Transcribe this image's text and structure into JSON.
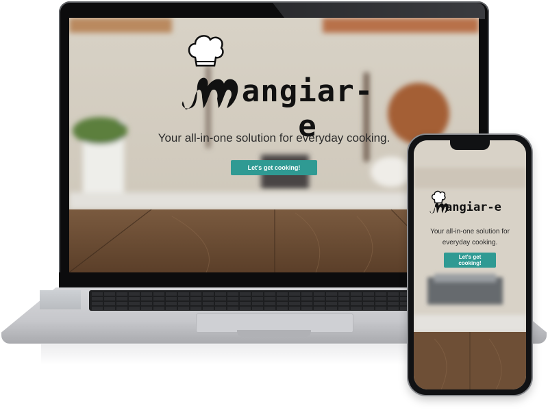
{
  "laptop": {
    "brand_name": "angiar-e",
    "tagline": "Your all-in-one solution for everyday cooking.",
    "cta_label": "Let's get cooking!"
  },
  "phone": {
    "brand_name": "angiar-e",
    "tagline": "Your all-in-one solution for everyday cooking.",
    "cta_label": "Let's get cooking!"
  },
  "colors": {
    "accent": "#2f9a93",
    "brand_text": "#111111",
    "device_frame": "#0c0c0d",
    "laptop_body": "#c6c7cb"
  },
  "icons": [
    "chef-hat-icon",
    "mustache-m-logo-icon"
  ]
}
